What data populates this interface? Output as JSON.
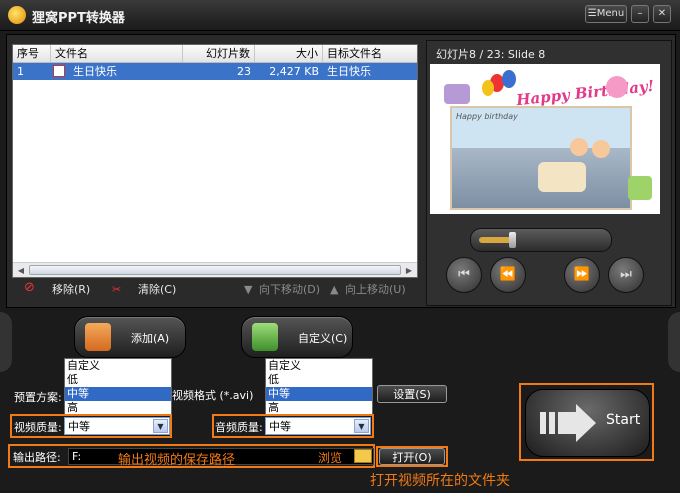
{
  "window": {
    "title": "狸窝PPT转换器",
    "menu_label": "Menu",
    "minimize": "–",
    "close": "✕"
  },
  "file_table": {
    "headers": {
      "index": "序号",
      "filename": "文件名",
      "slides": "幻灯片数",
      "size": "大小",
      "target": "目标文件名"
    },
    "rows": [
      {
        "index": "1",
        "filename": "生日快乐",
        "slides": "23",
        "size": "2,427 KB",
        "target": "生日快乐"
      }
    ]
  },
  "actions": {
    "remove": "移除(R)",
    "clear": "清除(C)",
    "move_down": "向下移动(D)",
    "move_up": "向上移动(U)"
  },
  "preview": {
    "caption": "幻灯片8 / 23: Slide 8",
    "banner_text": "Happy Birthday!",
    "card_text": "Happy birthday",
    "progress": 0.27
  },
  "buttons": {
    "add": "添加(A)",
    "customize": "自定义(C)",
    "settings": "设置(S)",
    "open": "打开(O)",
    "start": "Start"
  },
  "preset": {
    "label": "预置方案:",
    "value": "视频格式 (*.avi)"
  },
  "video_quality": {
    "label": "视频质量:",
    "value": "中等",
    "options": [
      "自定义",
      "低",
      "中等",
      "高"
    ],
    "selected": "中等"
  },
  "audio_quality": {
    "label": "音频质量:",
    "value": "中等",
    "options": [
      "自定义",
      "低",
      "中等",
      "高"
    ],
    "selected": "中等"
  },
  "output": {
    "label": "输出路径:",
    "value": "F:",
    "browse_label": "浏览"
  },
  "annotations": {
    "save_path": "输出视频的保存路径",
    "open_folder": "打开视频所在的文件夹"
  },
  "colors": {
    "accent": "#f07a14",
    "selection": "#3b73c8",
    "background": "#1b1b1b"
  }
}
